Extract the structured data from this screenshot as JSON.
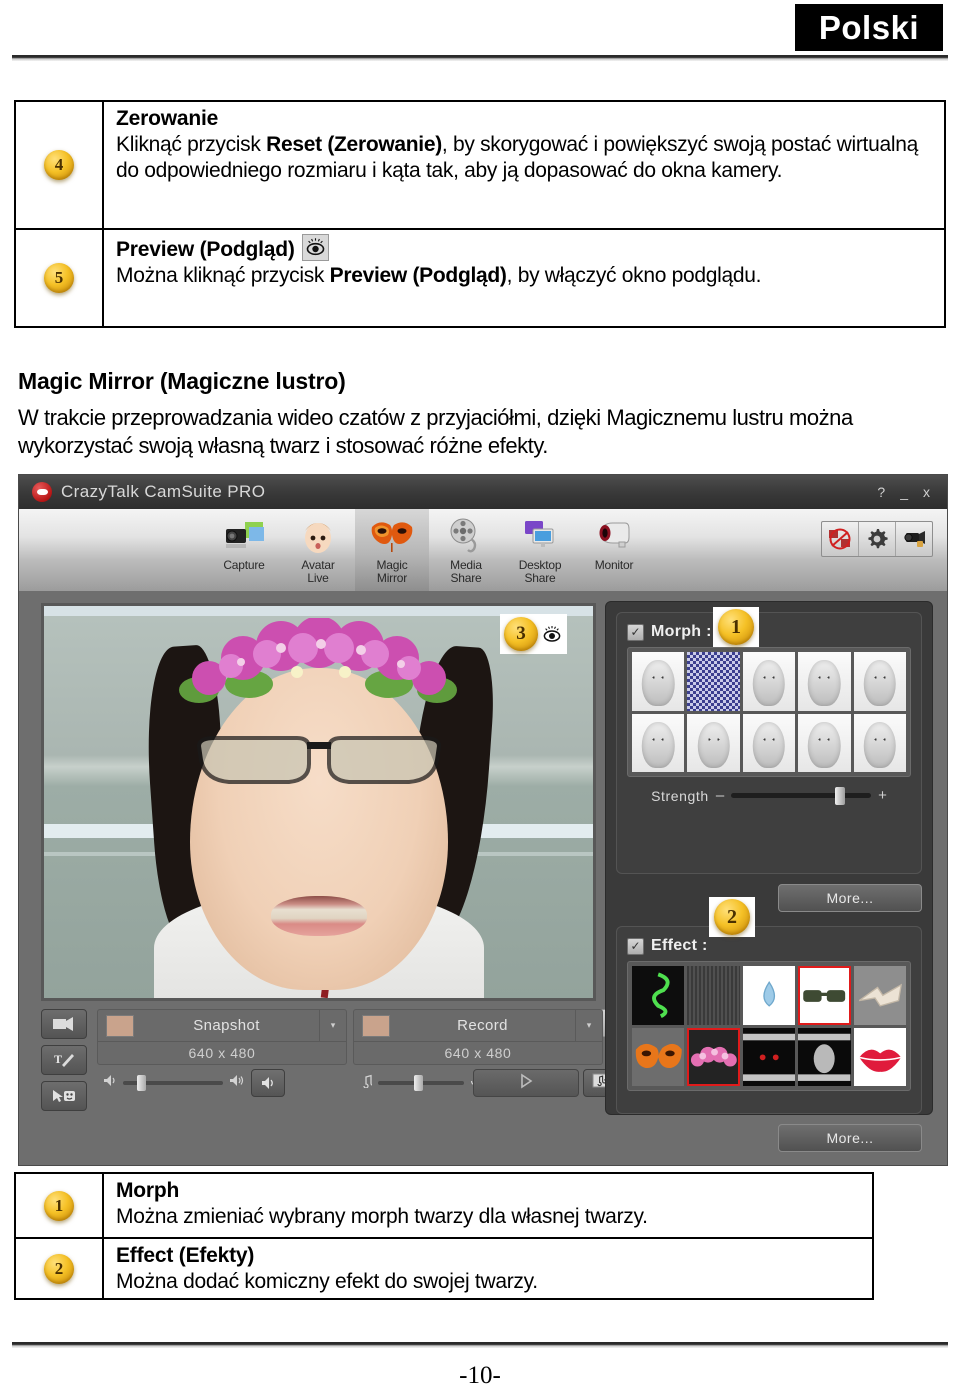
{
  "header": {
    "language_badge": "Polski"
  },
  "footer": {
    "page_number": "-10-"
  },
  "top_table": {
    "rows": [
      {
        "number": "4",
        "title": "Zerowanie",
        "body_pre": "Kliknąć przycisk ",
        "body_bold": "Reset (Zerowanie)",
        "body_post": ", by skorygować i powiększyć swoją postać wirtualną do odpowiedniego rozmiaru i kąta tak, aby ją dopasować do okna kamery.",
        "icon": ""
      },
      {
        "number": "5",
        "title": "Preview (Podgląd)",
        "title_icon": "eye-icon",
        "body_pre": "Można kliknąć przycisk ",
        "body_bold": "Preview (Podgląd)",
        "body_post": ", by włączyć okno podglądu."
      }
    ]
  },
  "section": {
    "heading": "Magic Mirror (Magiczne lustro)",
    "paragraph": "W trakcie przeprowadzania wideo czatów z przyjaciółmi, dzięki Magicznemu lustru można wykorzystać swoją własną twarz i stosować różne efekty."
  },
  "app": {
    "title": "CrazyTalk CamSuite PRO",
    "window_buttons": [
      "?",
      "_",
      "x"
    ],
    "tabs": [
      {
        "label_line1": "Capture",
        "label_line2": "",
        "icon": "camera-photo-icon",
        "selected": false
      },
      {
        "label_line1": "Avatar",
        "label_line2": "Live",
        "icon": "baby-face-icon",
        "selected": false
      },
      {
        "label_line1": "Magic",
        "label_line2": "Mirror",
        "icon": "mask-icon",
        "selected": true
      },
      {
        "label_line1": "Media",
        "label_line2": "Share",
        "icon": "film-reel-icon",
        "selected": false
      },
      {
        "label_line1": "Desktop",
        "label_line2": "Share",
        "icon": "monitors-icon",
        "selected": false
      },
      {
        "label_line1": "Monitor",
        "label_line2": "",
        "icon": "webcam-icon",
        "selected": false
      }
    ],
    "tool_buttons": [
      "no-video-icon",
      "gear-icon",
      "webcam-setup-icon"
    ],
    "video_marker": {
      "number": "3",
      "icon": "eye-icon"
    },
    "side_buttons": [
      "camera-switch-icon",
      "text-tool-icon",
      "pointer-emoticon-icon"
    ],
    "capture": [
      {
        "label": "Snapshot",
        "resolution": "640 x 480",
        "caret": "▾"
      },
      {
        "label": "Record",
        "resolution": "640 x 480",
        "caret": "▾"
      }
    ],
    "audio": {
      "speaker_icon": "speaker-icon",
      "speaker_loud_icon": "speaker-loud-icon",
      "mute_button_icon": "speaker-button-icon"
    },
    "music": {
      "note_icon": "music-note-icon",
      "mic_icon": "microphone-icon",
      "button_icon": "audio-mixer-icon"
    },
    "play": {
      "play_icon": "play-icon",
      "media_icon": "music-file-icon"
    },
    "morph_panel": {
      "label": "Morph :",
      "checked": true,
      "marker_number": "1",
      "thumbnails": [
        {
          "selected": false,
          "style": "face"
        },
        {
          "selected": true,
          "style": "checker"
        },
        {
          "selected": false,
          "style": "face"
        },
        {
          "selected": false,
          "style": "face"
        },
        {
          "selected": false,
          "style": "face"
        },
        {
          "selected": false,
          "style": "face"
        },
        {
          "selected": false,
          "style": "face"
        },
        {
          "selected": false,
          "style": "face"
        },
        {
          "selected": false,
          "style": "face"
        },
        {
          "selected": false,
          "style": "face"
        }
      ],
      "strength_label": "Strength",
      "strength_minus": "–",
      "strength_plus": "+",
      "strength_value": 74,
      "more_label": "More..."
    },
    "effect_panel": {
      "label": "Effect :",
      "checked": true,
      "marker_number": "2",
      "thumbnails": [
        {
          "selected": false,
          "name": "green-swirl-effect",
          "bg": "#0d0d0d",
          "fg": "#4fe04f"
        },
        {
          "selected": false,
          "name": "static-noise-effect",
          "bg": "#414141",
          "fg": "#5a5a5a"
        },
        {
          "selected": false,
          "name": "water-drop-effect",
          "bg": "#ffffff",
          "fg": "#8fc4e8"
        },
        {
          "selected": true,
          "name": "sunglasses-effect",
          "bg": "#ffffff",
          "fg": "#3f4a35"
        },
        {
          "selected": false,
          "name": "bandage-effect",
          "bg": "#8e8e8e",
          "fg": "#e8dfd2"
        },
        {
          "selected": false,
          "name": "fire-mask-effect",
          "bg": "#6d6d6d",
          "fg": "#e8761a"
        },
        {
          "selected": true,
          "name": "flower-crown-effect",
          "bg": "#232323",
          "fg": "#e36fb2"
        },
        {
          "selected": false,
          "name": "red-eyes-effect",
          "bg": "#0a0a0a",
          "fg": "#d02020"
        },
        {
          "selected": false,
          "name": "ghost-effect",
          "bg": "#0a0a0a",
          "fg": "#cfcfcf"
        },
        {
          "selected": false,
          "name": "red-lips-effect",
          "bg": "#ffffff",
          "fg": "#e01b3c"
        }
      ],
      "more_label": "More..."
    }
  },
  "bottom_table": {
    "rows": [
      {
        "number": "1",
        "title": "Morph",
        "body": "Można zmieniać wybrany morph twarzy dla własnej twarzy."
      },
      {
        "number": "2",
        "title": "Effect (Efekty)",
        "body": "Można dodać komiczny efekt do swojej twarzy."
      }
    ]
  },
  "colors": {
    "badge": "#f5c126",
    "accent_red": "#e01b1b",
    "app_dark": "#3a3a3a"
  }
}
